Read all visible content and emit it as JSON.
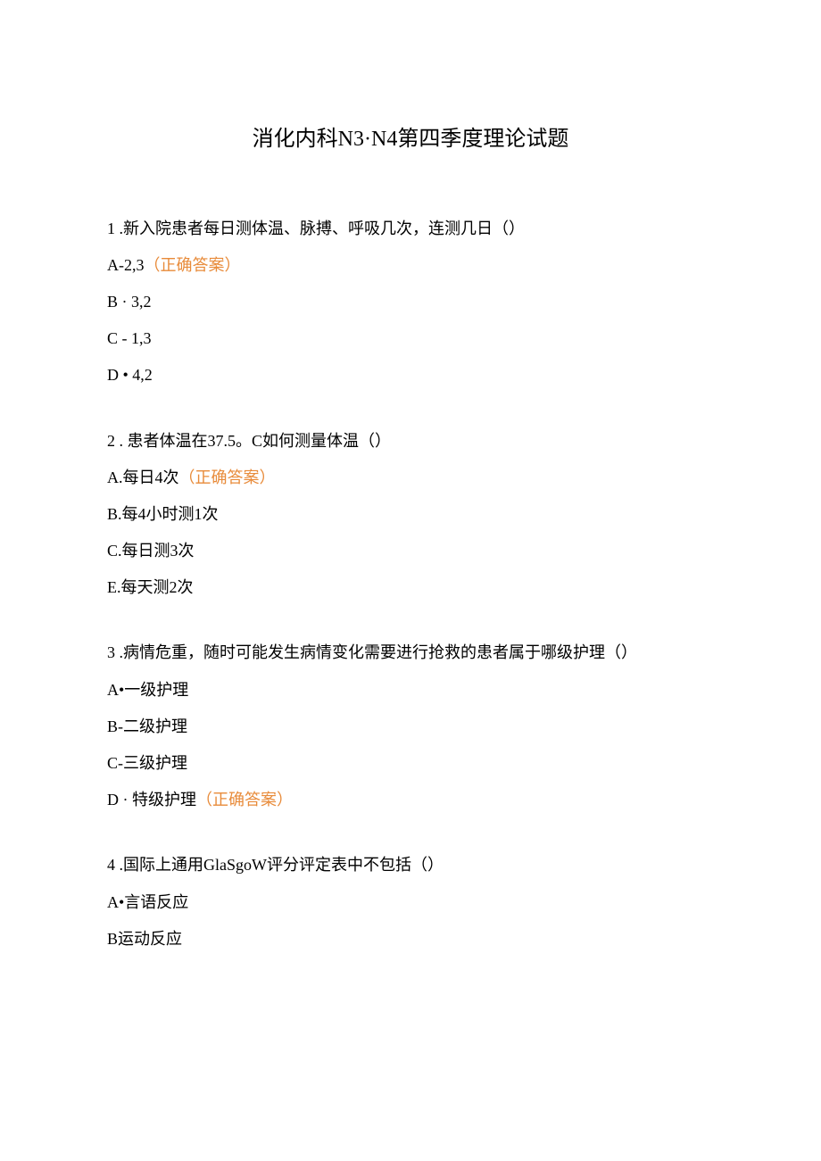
{
  "title": "消化内科N3·N4第四季度理论试题",
  "q1": {
    "text": "1 .新入院患者每日测体温、脉搏、呼吸几次，连测几日（）",
    "a_prefix": "A-2,3",
    "a_correct": "（正确答案）",
    "b": "B  ·  3,2",
    "c": "C - 1,3",
    "d": "D • 4,2"
  },
  "q2": {
    "text": "2  . 患者体温在37.5。C如何测量体温（）",
    "a_prefix": "A.每日4次",
    "a_correct": "（正确答案）",
    "b": "B.每4小时测1次",
    "c": "C.每日测3次",
    "e": "E.每天测2次"
  },
  "q3": {
    "text": "3  .病情危重，随时可能发生病情变化需要进行抢救的患者属于哪级护理（）",
    "a": "A•一级护理",
    "b": "B-二级护理",
    "c": "C-三级护理",
    "d_prefix": "D · 特级护理",
    "d_correct": "（正确答案）"
  },
  "q4": {
    "text": "4  .国际上通用GlaSgoW评分评定表中不包括（）",
    "a": "A•言语反应",
    "b": "B运动反应"
  }
}
